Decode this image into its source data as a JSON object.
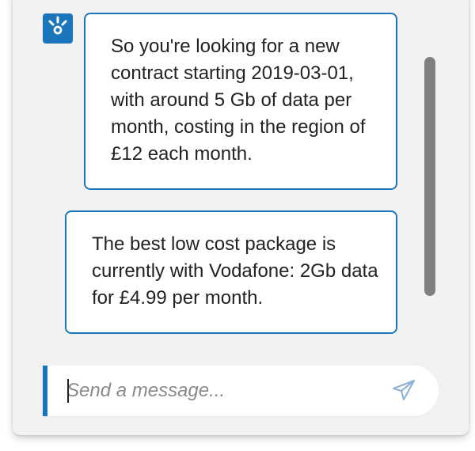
{
  "chat": {
    "messages": [
      {
        "sender": "bot",
        "text": "So you're looking for a new contract starting 2019-03-01, with around 5 Gb of data per month, costing in the region of £12 each month."
      },
      {
        "sender": "bot",
        "text": "The best low cost package is currently with Vodafone: 2Gb data for £4.99 per month."
      }
    ]
  },
  "composer": {
    "placeholder": "Send a message...",
    "value": ""
  },
  "icons": {
    "avatar": "bot-logo-icon",
    "send": "paper-plane-icon"
  },
  "colors": {
    "accent": "#1b75bb",
    "panel_bg": "#f2f2f2",
    "scrollbar": "#808080",
    "send_icon": "#8fb4d6"
  }
}
